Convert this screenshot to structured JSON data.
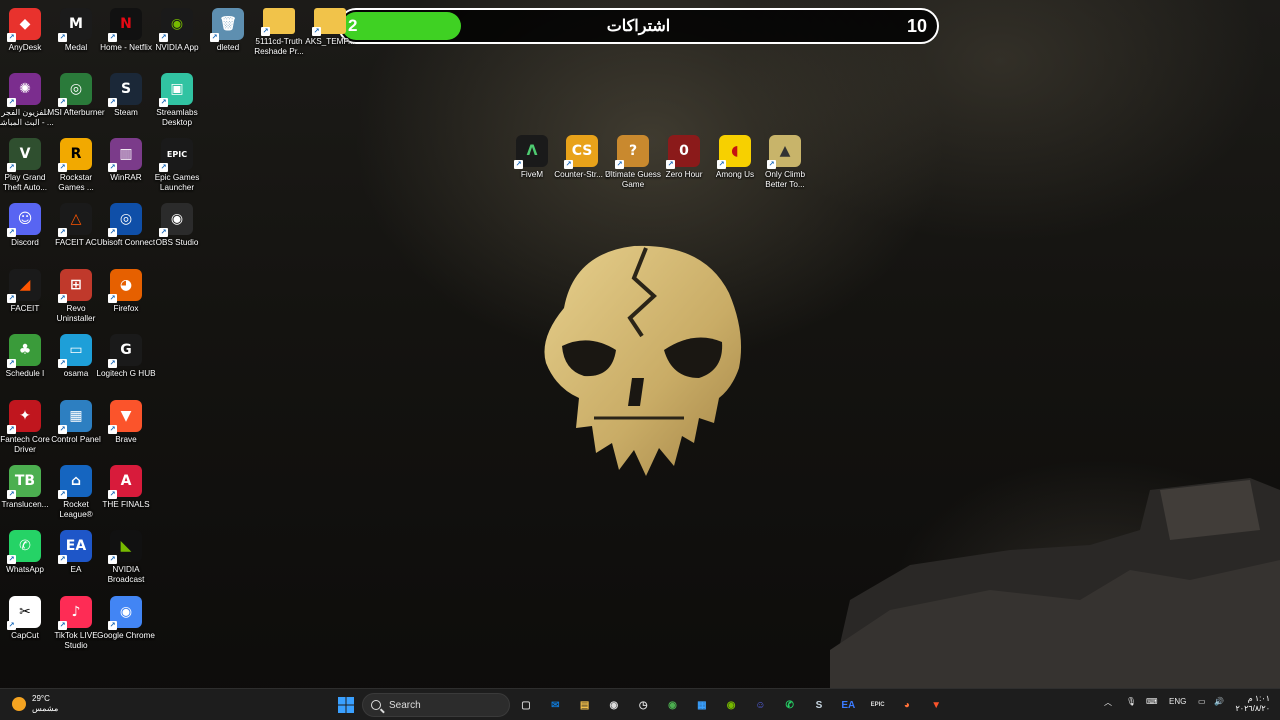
{
  "overlay": {
    "current": "2",
    "title": "اشتراكات",
    "goal": "10",
    "progress": 0.2,
    "color": "#3fd123"
  },
  "desktop_icons": [
    {
      "label": "AnyDesk",
      "glyph": "◆",
      "bg": "#e8322d"
    },
    {
      "label": "Medal",
      "glyph": "M",
      "bg": "#1b1b1b"
    },
    {
      "label": "Home - Netflix",
      "glyph": "N",
      "bg": "#111111",
      "fg": "#e50914"
    },
    {
      "label": "NVIDIA App",
      "glyph": "◉",
      "bg": "#1a1a1a",
      "fg": "#76b900"
    },
    {
      "label": "dleted",
      "glyph": "🗑",
      "bg": "#5e8fb0"
    },
    {
      "label": "5111cd-Truth Reshade Pr...",
      "glyph": "",
      "bg": "#f1c34a"
    },
    {
      "label": "AKS_TEMP...",
      "glyph": "",
      "bg": "#f1c34a"
    },
    {
      "label": "تلفزيون الفجر البث المباشر - ...",
      "glyph": "✺",
      "bg": "#7b2d8e"
    },
    {
      "label": "MSI Afterburner",
      "glyph": "◎",
      "bg": "#2a7a3a"
    },
    {
      "label": "Steam",
      "glyph": "S",
      "bg": "#1b2838"
    },
    {
      "label": "Streamlabs Desktop",
      "glyph": "▣",
      "bg": "#31c3a2"
    },
    {
      "label": "Play Grand Theft Auto...",
      "glyph": "V",
      "bg": "#2f4f2f"
    },
    {
      "label": "Rockstar Games ...",
      "glyph": "R",
      "bg": "#f2a900",
      "fg": "#000"
    },
    {
      "label": "WinRAR",
      "glyph": "▥",
      "bg": "#7b3b8a"
    },
    {
      "label": "Epic Games Launcher",
      "glyph": "EPIC",
      "bg": "#1a1a1a"
    },
    {
      "label": "Discord",
      "glyph": "☺",
      "bg": "#5865f2"
    },
    {
      "label": "FACEIT AC",
      "glyph": "△",
      "bg": "#1a1a1a",
      "fg": "#ff5500"
    },
    {
      "label": "Ubisoft Connect",
      "glyph": "◎",
      "bg": "#0f4fa8"
    },
    {
      "label": "OBS Studio",
      "glyph": "◉",
      "bg": "#2b2b2b"
    },
    {
      "label": "FACEIT",
      "glyph": "◢",
      "bg": "#1a1a1a",
      "fg": "#ff5500"
    },
    {
      "label": "Revo Uninstaller",
      "glyph": "⊞",
      "bg": "#c0392b"
    },
    {
      "label": "Firefox",
      "glyph": "◕",
      "bg": "#e66000"
    },
    {
      "label": "Schedule I",
      "glyph": "♣",
      "bg": "#3a9b3a"
    },
    {
      "label": "osama",
      "glyph": "▭",
      "bg": "#1e9fd8"
    },
    {
      "label": "Logitech G HUB",
      "glyph": "G",
      "bg": "#1a1a1a"
    },
    {
      "label": "Fantech Core Driver",
      "glyph": "✦",
      "bg": "#c0161e"
    },
    {
      "label": "Control Panel",
      "glyph": "▦",
      "bg": "#2d7fc1"
    },
    {
      "label": "Brave",
      "glyph": "▼",
      "bg": "#fb542b"
    },
    {
      "label": "Translucen...",
      "glyph": "TB",
      "bg": "#4caf50"
    },
    {
      "label": "Rocket League®",
      "glyph": "⌂",
      "bg": "#1565c0"
    },
    {
      "label": "THE FINALS",
      "glyph": "A",
      "bg": "#d81b3b"
    },
    {
      "label": "WhatsApp",
      "glyph": "✆",
      "bg": "#25d366"
    },
    {
      "label": "EA",
      "glyph": "EA",
      "bg": "#1e56c8"
    },
    {
      "label": "NVIDIA Broadcast",
      "glyph": "◣",
      "bg": "#111111",
      "fg": "#76b900"
    },
    {
      "label": "CapCut",
      "glyph": "✂",
      "bg": "#ffffff",
      "fg": "#000"
    },
    {
      "label": "TikTok LIVE Studio",
      "glyph": "♪",
      "bg": "#fe2c55"
    },
    {
      "label": "Google Chrome",
      "glyph": "◉",
      "bg": "#4285f4"
    },
    {
      "label": "FiveM",
      "glyph": "Λ",
      "bg": "#1a1a1a",
      "fg": "#4ecb71"
    },
    {
      "label": "Counter-Str... 2",
      "glyph": "CS",
      "bg": "#e8a21a"
    },
    {
      "label": "Ultimate Guess Game",
      "glyph": "?",
      "bg": "#c9892e"
    },
    {
      "label": "Zero Hour",
      "glyph": "0",
      "bg": "#8b1a1a"
    },
    {
      "label": "Among Us",
      "glyph": "◖",
      "bg": "#f7d000",
      "fg": "#c51111"
    },
    {
      "label": "Only Climb Better To...",
      "glyph": "▲",
      "bg": "#c8b46a",
      "fg": "#333"
    }
  ],
  "taskbar": {
    "weather_temp": "29°C",
    "weather_desc": "مشمس",
    "search_placeholder": "Search",
    "apps": [
      {
        "name": "task-view",
        "glyph": "▢",
        "color": "#cccccc"
      },
      {
        "name": "outlook",
        "glyph": "✉",
        "color": "#0f78d4"
      },
      {
        "name": "file-explorer",
        "glyph": "▤",
        "color": "#f4c14b"
      },
      {
        "name": "obs",
        "glyph": "◉",
        "color": "#dddddd"
      },
      {
        "name": "speedometer",
        "glyph": "◷",
        "color": "#dddddd"
      },
      {
        "name": "chrome",
        "glyph": "◉",
        "color": "#4caf50"
      },
      {
        "name": "store",
        "glyph": "▦",
        "color": "#3aa0ff"
      },
      {
        "name": "nvidia",
        "glyph": "◉",
        "color": "#76b900"
      },
      {
        "name": "discord",
        "glyph": "☺",
        "color": "#5865f2"
      },
      {
        "name": "whatsapp",
        "glyph": "✆",
        "color": "#25d366"
      },
      {
        "name": "steam",
        "glyph": "S",
        "color": "#c7d5e0"
      },
      {
        "name": "ea",
        "glyph": "EA",
        "color": "#3b7bff"
      },
      {
        "name": "epic",
        "glyph": "EPIC",
        "color": "#dddddd"
      },
      {
        "name": "firefox",
        "glyph": "◕",
        "color": "#ff7139"
      },
      {
        "name": "brave",
        "glyph": "▼",
        "color": "#fb542b"
      }
    ],
    "lang": "ENG",
    "time": "١:٠١ م",
    "date": "٢٠٢٦/٨/٢٠"
  }
}
